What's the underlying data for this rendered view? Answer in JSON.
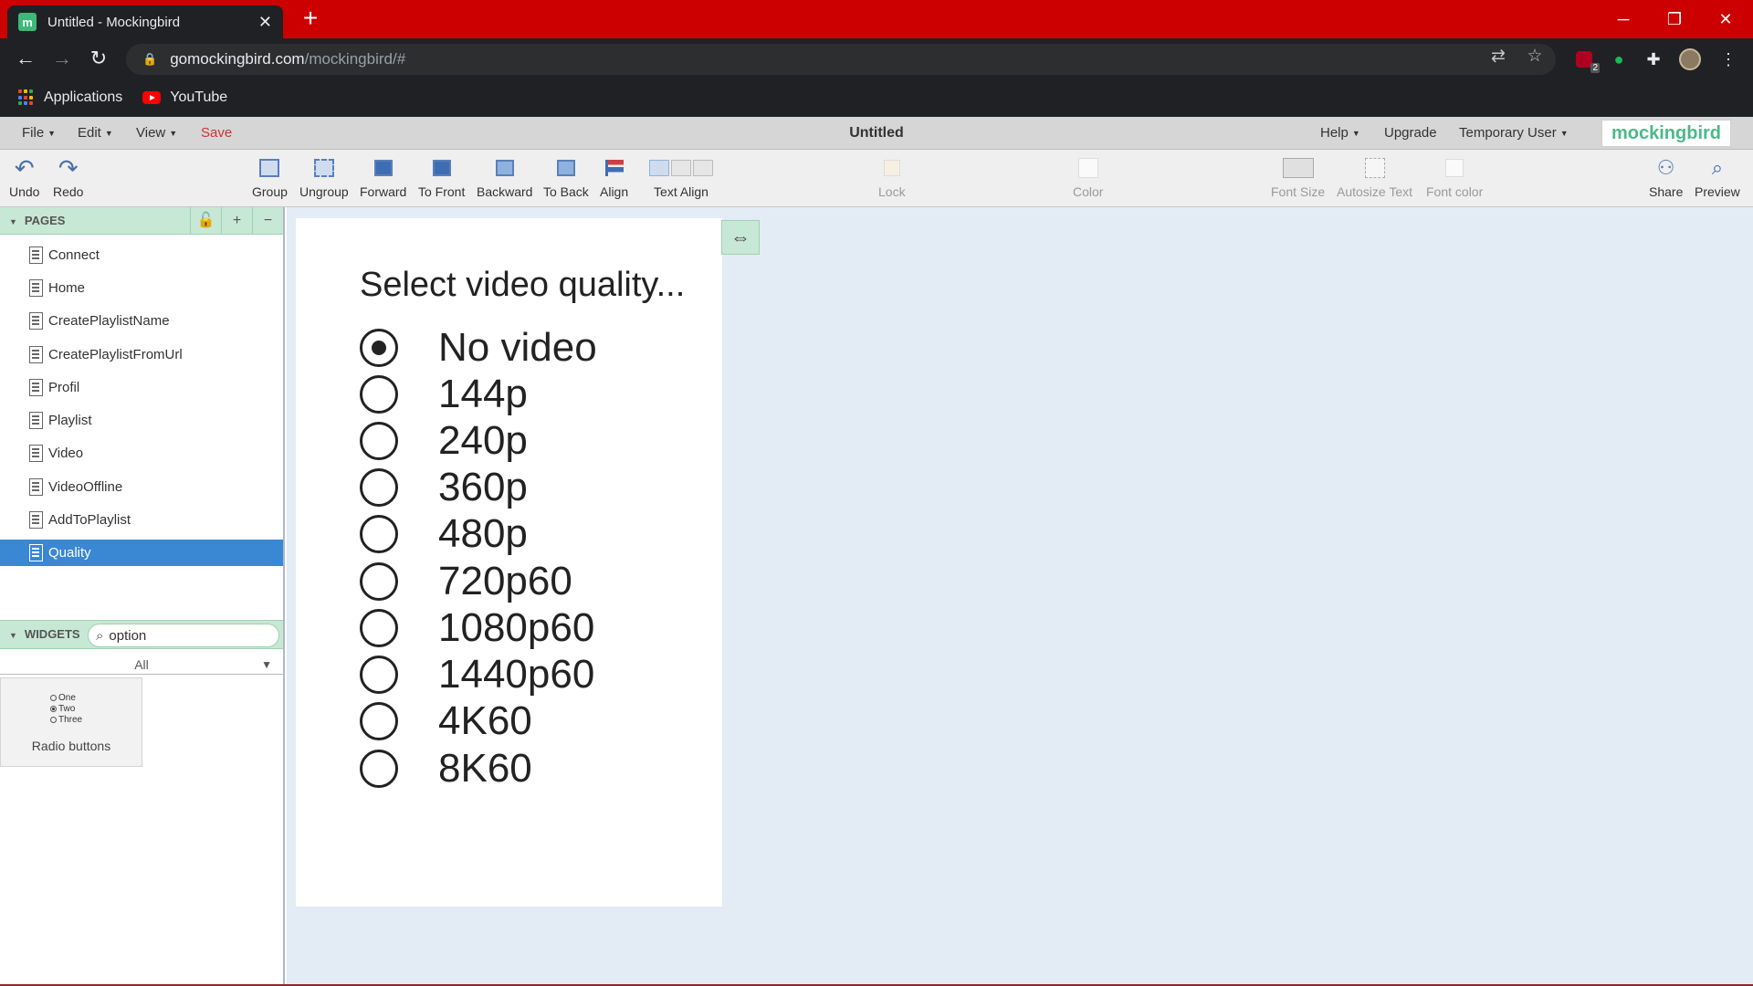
{
  "browser": {
    "tab_title": "Untitled - Mockingbird",
    "favicon_letter": "m",
    "url_domain": "gomockingbird.com",
    "url_path": "/mockingbird/#",
    "extension_badge": "2",
    "bookmarks": [
      {
        "label": "Applications",
        "icon": "apps-grid-icon"
      },
      {
        "label": "YouTube",
        "icon": "youtube-icon"
      }
    ]
  },
  "app": {
    "menus": [
      {
        "label": "File"
      },
      {
        "label": "Edit"
      },
      {
        "label": "View"
      }
    ],
    "save_label": "Save",
    "document_title": "Untitled",
    "right_menus": {
      "help": "Help",
      "upgrade": "Upgrade",
      "user": "Temporary User"
    },
    "brand": "mockingbird"
  },
  "toolbar": {
    "undo": "Undo",
    "redo": "Redo",
    "group": "Group",
    "ungroup": "Ungroup",
    "forward": "Forward",
    "to_front": "To Front",
    "backward": "Backward",
    "to_back": "To Back",
    "align": "Align",
    "text_align": "Text Align",
    "lock": "Lock",
    "color": "Color",
    "font_size": "Font Size",
    "autosize_text": "Autosize Text",
    "font_color": "Font color",
    "share": "Share",
    "preview": "Preview"
  },
  "pages": {
    "header": "PAGES",
    "items": [
      {
        "label": "Connect",
        "selected": false
      },
      {
        "label": "Home",
        "selected": false
      },
      {
        "label": "CreatePlaylistName",
        "selected": false
      },
      {
        "label": "CreatePlaylistFromUrl",
        "selected": false
      },
      {
        "label": "Profil",
        "selected": false
      },
      {
        "label": "Playlist",
        "selected": false
      },
      {
        "label": "Video",
        "selected": false
      },
      {
        "label": "VideoOffline",
        "selected": false
      },
      {
        "label": "AddToPlaylist",
        "selected": false
      },
      {
        "label": "Quality",
        "selected": true
      }
    ]
  },
  "widgets": {
    "header": "WIDGETS",
    "search_value": "option",
    "filter": "All",
    "items": [
      {
        "label": "Radio buttons",
        "preview_options": [
          "One",
          "Two",
          "Three"
        ],
        "preview_selected": "Two"
      }
    ]
  },
  "canvas": {
    "heading": "Select video quality...",
    "options": [
      {
        "label": "No video",
        "selected": true
      },
      {
        "label": "144p",
        "selected": false
      },
      {
        "label": "240p",
        "selected": false
      },
      {
        "label": "360p",
        "selected": false
      },
      {
        "label": "480p",
        "selected": false
      },
      {
        "label": "720p60",
        "selected": false
      },
      {
        "label": "1080p60",
        "selected": false
      },
      {
        "label": "1440p60",
        "selected": false
      },
      {
        "label": "4K60",
        "selected": false
      },
      {
        "label": "8K60",
        "selected": false
      }
    ]
  },
  "colors": {
    "titlebar": "#cc0000",
    "chrome_dark": "#202124",
    "panel_header": "#c7e8d4",
    "selected_page": "#3a87d4",
    "canvas_bg": "#e3ebf5",
    "brand": "#4cb88a",
    "save": "#cc3333"
  }
}
